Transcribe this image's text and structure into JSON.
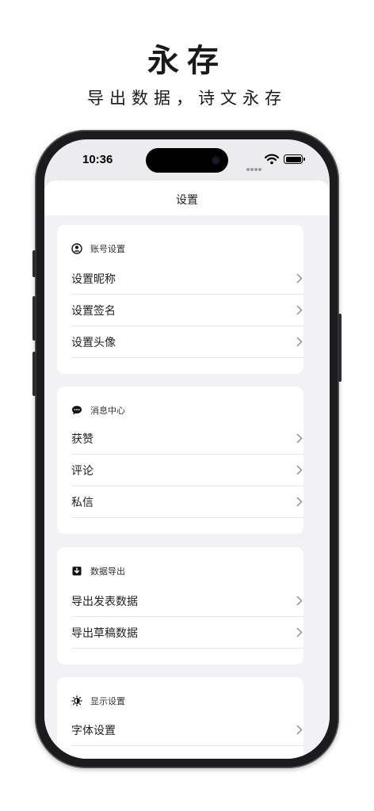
{
  "promo": {
    "title": "永存",
    "subtitle": "导出数据，诗文永存"
  },
  "status_bar": {
    "time": "10:36"
  },
  "nav": {
    "title": "设置"
  },
  "sections": [
    {
      "label": "账号设置",
      "icon": "person-circle-icon",
      "items": [
        {
          "label": "设置昵称"
        },
        {
          "label": "设置签名"
        },
        {
          "label": "设置头像"
        }
      ]
    },
    {
      "label": "消息中心",
      "icon": "message-bubble-icon",
      "items": [
        {
          "label": "获赞"
        },
        {
          "label": "评论"
        },
        {
          "label": "私信"
        }
      ]
    },
    {
      "label": "数据导出",
      "icon": "download-icon",
      "items": [
        {
          "label": "导出发表数据"
        },
        {
          "label": "导出草稿数据"
        }
      ]
    },
    {
      "label": "显示设置",
      "icon": "brightness-icon",
      "items": [
        {
          "label": "字体设置"
        }
      ]
    }
  ],
  "colors": {
    "background": "#f2f2f4",
    "card": "#ffffff",
    "phone_frame": "#1b1b1d",
    "separator": "#e6e6e8",
    "chevron": "#8e8e93"
  }
}
